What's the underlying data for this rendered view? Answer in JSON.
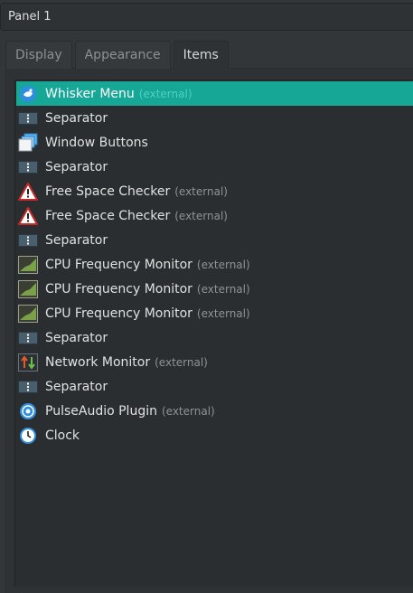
{
  "panel": {
    "selected": "Panel 1"
  },
  "tabs": [
    {
      "label": "Display"
    },
    {
      "label": "Appearance"
    },
    {
      "label": "Items"
    }
  ],
  "items": [
    {
      "name": "Whisker Menu",
      "ext": "(external)",
      "icon": "whisker-menu-icon"
    },
    {
      "name": "Separator",
      "ext": "",
      "icon": "separator-icon"
    },
    {
      "name": "Window Buttons",
      "ext": "",
      "icon": "window-buttons-icon"
    },
    {
      "name": "Separator",
      "ext": "",
      "icon": "separator-icon"
    },
    {
      "name": "Free Space Checker",
      "ext": "(external)",
      "icon": "warning-icon"
    },
    {
      "name": "Free Space Checker",
      "ext": "(external)",
      "icon": "warning-icon"
    },
    {
      "name": "Separator",
      "ext": "",
      "icon": "separator-icon"
    },
    {
      "name": "CPU Frequency Monitor",
      "ext": "(external)",
      "icon": "cpu-graph-icon"
    },
    {
      "name": "CPU Frequency Monitor",
      "ext": "(external)",
      "icon": "cpu-graph-icon"
    },
    {
      "name": "CPU Frequency Monitor",
      "ext": "(external)",
      "icon": "cpu-graph-icon"
    },
    {
      "name": "Separator",
      "ext": "",
      "icon": "separator-icon"
    },
    {
      "name": "Network Monitor",
      "ext": "(external)",
      "icon": "network-monitor-icon"
    },
    {
      "name": "Separator",
      "ext": "",
      "icon": "separator-icon"
    },
    {
      "name": "PulseAudio Plugin",
      "ext": "(external)",
      "icon": "pulseaudio-icon"
    },
    {
      "name": "Clock",
      "ext": "",
      "icon": "clock-icon"
    }
  ]
}
